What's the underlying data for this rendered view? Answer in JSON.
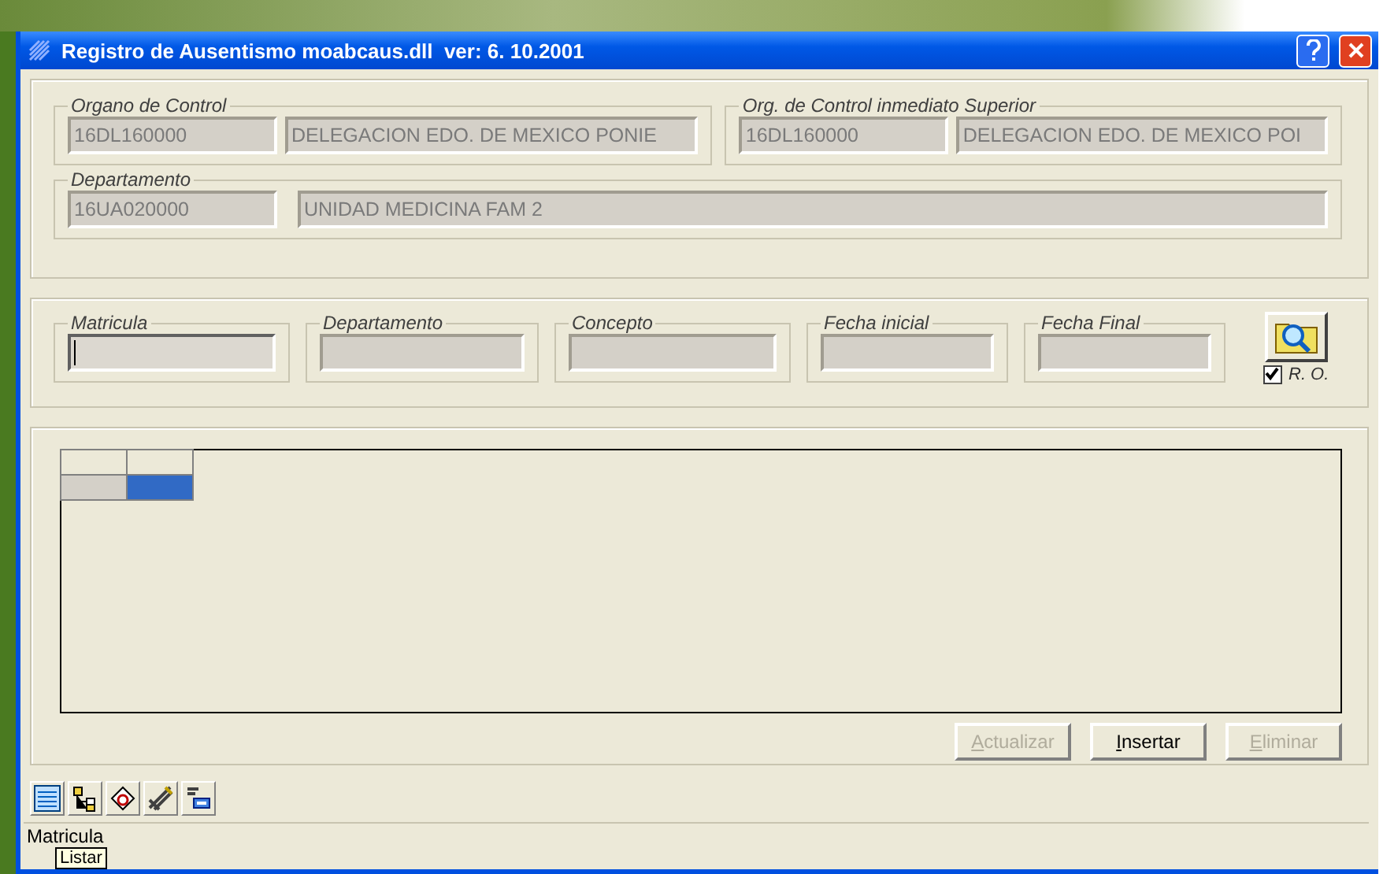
{
  "window": {
    "title": "Registro de Ausentismo moabcaus.dll  ver: 6. 10.2001"
  },
  "control_groups": [
    {
      "legend": "Organo de Control",
      "code": "16DL160000",
      "name": "DELEGACION EDO. DE MEXICO PONIE"
    },
    {
      "legend": "Org. de Control inmediato Superior",
      "code": "16DL160000",
      "name": "DELEGACION EDO. DE MEXICO POI"
    }
  ],
  "department": {
    "legend": "Departamento",
    "code": "16UA020000",
    "name": "UNIDAD MEDICINA FAM 2"
  },
  "filters": [
    {
      "legend": "Matricula",
      "focused": true
    },
    {
      "legend": "Departamento",
      "focused": false
    },
    {
      "legend": "Concepto",
      "focused": false
    },
    {
      "legend": "Fecha inicial",
      "focused": false
    },
    {
      "legend": "Fecha Final",
      "focused": false
    }
  ],
  "ro_checkbox": {
    "label": "R. O.",
    "checked": true
  },
  "grid": {
    "rows": [
      {
        "cells": [
          {
            "selected": false
          },
          {
            "selected": false
          }
        ]
      },
      {
        "cells": [
          {
            "selected": false
          },
          {
            "selected": true
          }
        ]
      }
    ]
  },
  "buttons": [
    {
      "label": "Actualizar",
      "disabled": true
    },
    {
      "label": "Insertar",
      "disabled": false
    },
    {
      "label": "Eliminar",
      "disabled": true
    }
  ],
  "status_bar": {
    "text": "Matricula"
  },
  "tooltip": {
    "text": "Listar"
  }
}
